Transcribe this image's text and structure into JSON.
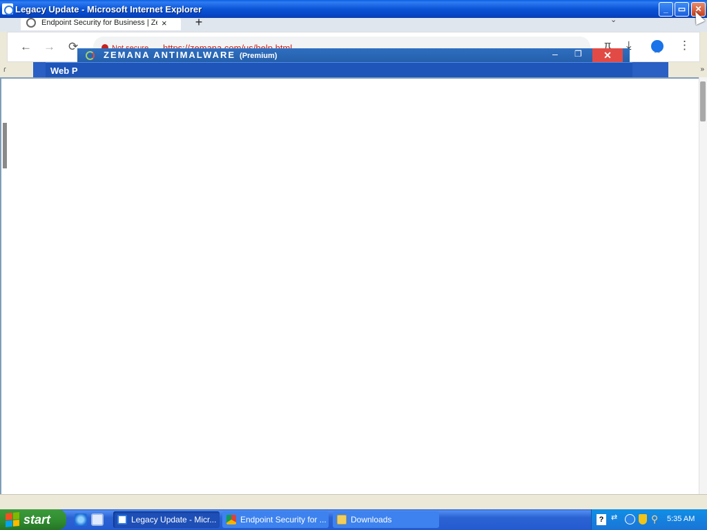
{
  "ie_window": {
    "title": "Legacy Update - Microsoft Internet Explorer",
    "buttons": {
      "minimize": "_",
      "maximize": "▭",
      "close": "✕"
    }
  },
  "browser": {
    "tab_title": "Endpoint Security for Business | Ze",
    "tab_close": "×",
    "new_tab": "+",
    "tab_search": "⌄",
    "nav": {
      "back": "←",
      "forward": "→",
      "reload": "⟳"
    },
    "security_label": "Not secure",
    "url": "https://zemana.com/us/help.html",
    "bookmark": "☆",
    "extension": "π",
    "download": "⤓",
    "more": "⋮"
  },
  "zemana_window": {
    "name": "ZEMANA ANTIMALWARE",
    "edition": "(Premium)",
    "minimize": "–",
    "maximize": "❐",
    "close": "✕"
  },
  "ie_page": {
    "panel_title": "Web P",
    "left_stub": "ɾ",
    "right_stub": "»"
  },
  "taskbar": {
    "start_label": "start",
    "tasks": [
      {
        "label": "Legacy Update - Micr...",
        "icon": "ie-icon"
      },
      {
        "label": "Endpoint Security for ...",
        "icon": "chrome-icon"
      },
      {
        "label": "Downloads",
        "icon": "folder-icon"
      }
    ],
    "tray_help": "?",
    "tray_network": "⇄",
    "tray_search": "⚲",
    "clock": "5:35 AM"
  },
  "colors": {
    "xp_blue": "#0a55d6",
    "start_green": "#2e8b2e",
    "zemana_close": "#e24b45",
    "not_secure": "#c5221f"
  }
}
